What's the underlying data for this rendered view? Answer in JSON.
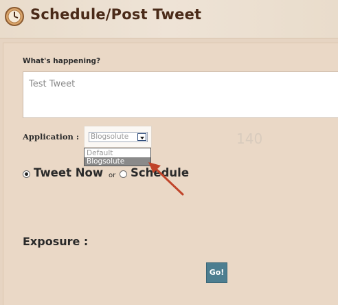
{
  "header": {
    "title": "Schedule/Post Tweet",
    "icon": "clock-icon"
  },
  "form": {
    "happening_label": "What's happening?",
    "tweet_value": "Test Tweet",
    "application_label": "Application :",
    "selected_application": "Blogsolute",
    "application_options": [
      "Default",
      "Blogsolute"
    ],
    "char_count": "140",
    "tweet_now_label": "Tweet Now",
    "or_label": "or",
    "schedule_label": "Schedule",
    "exposure_label": "Exposure :",
    "go_label": "Go!"
  },
  "colors": {
    "background": "#e6d4c2",
    "title": "#4a2a18",
    "go_button": "#4d7e90",
    "arrow": "#c0442a"
  }
}
